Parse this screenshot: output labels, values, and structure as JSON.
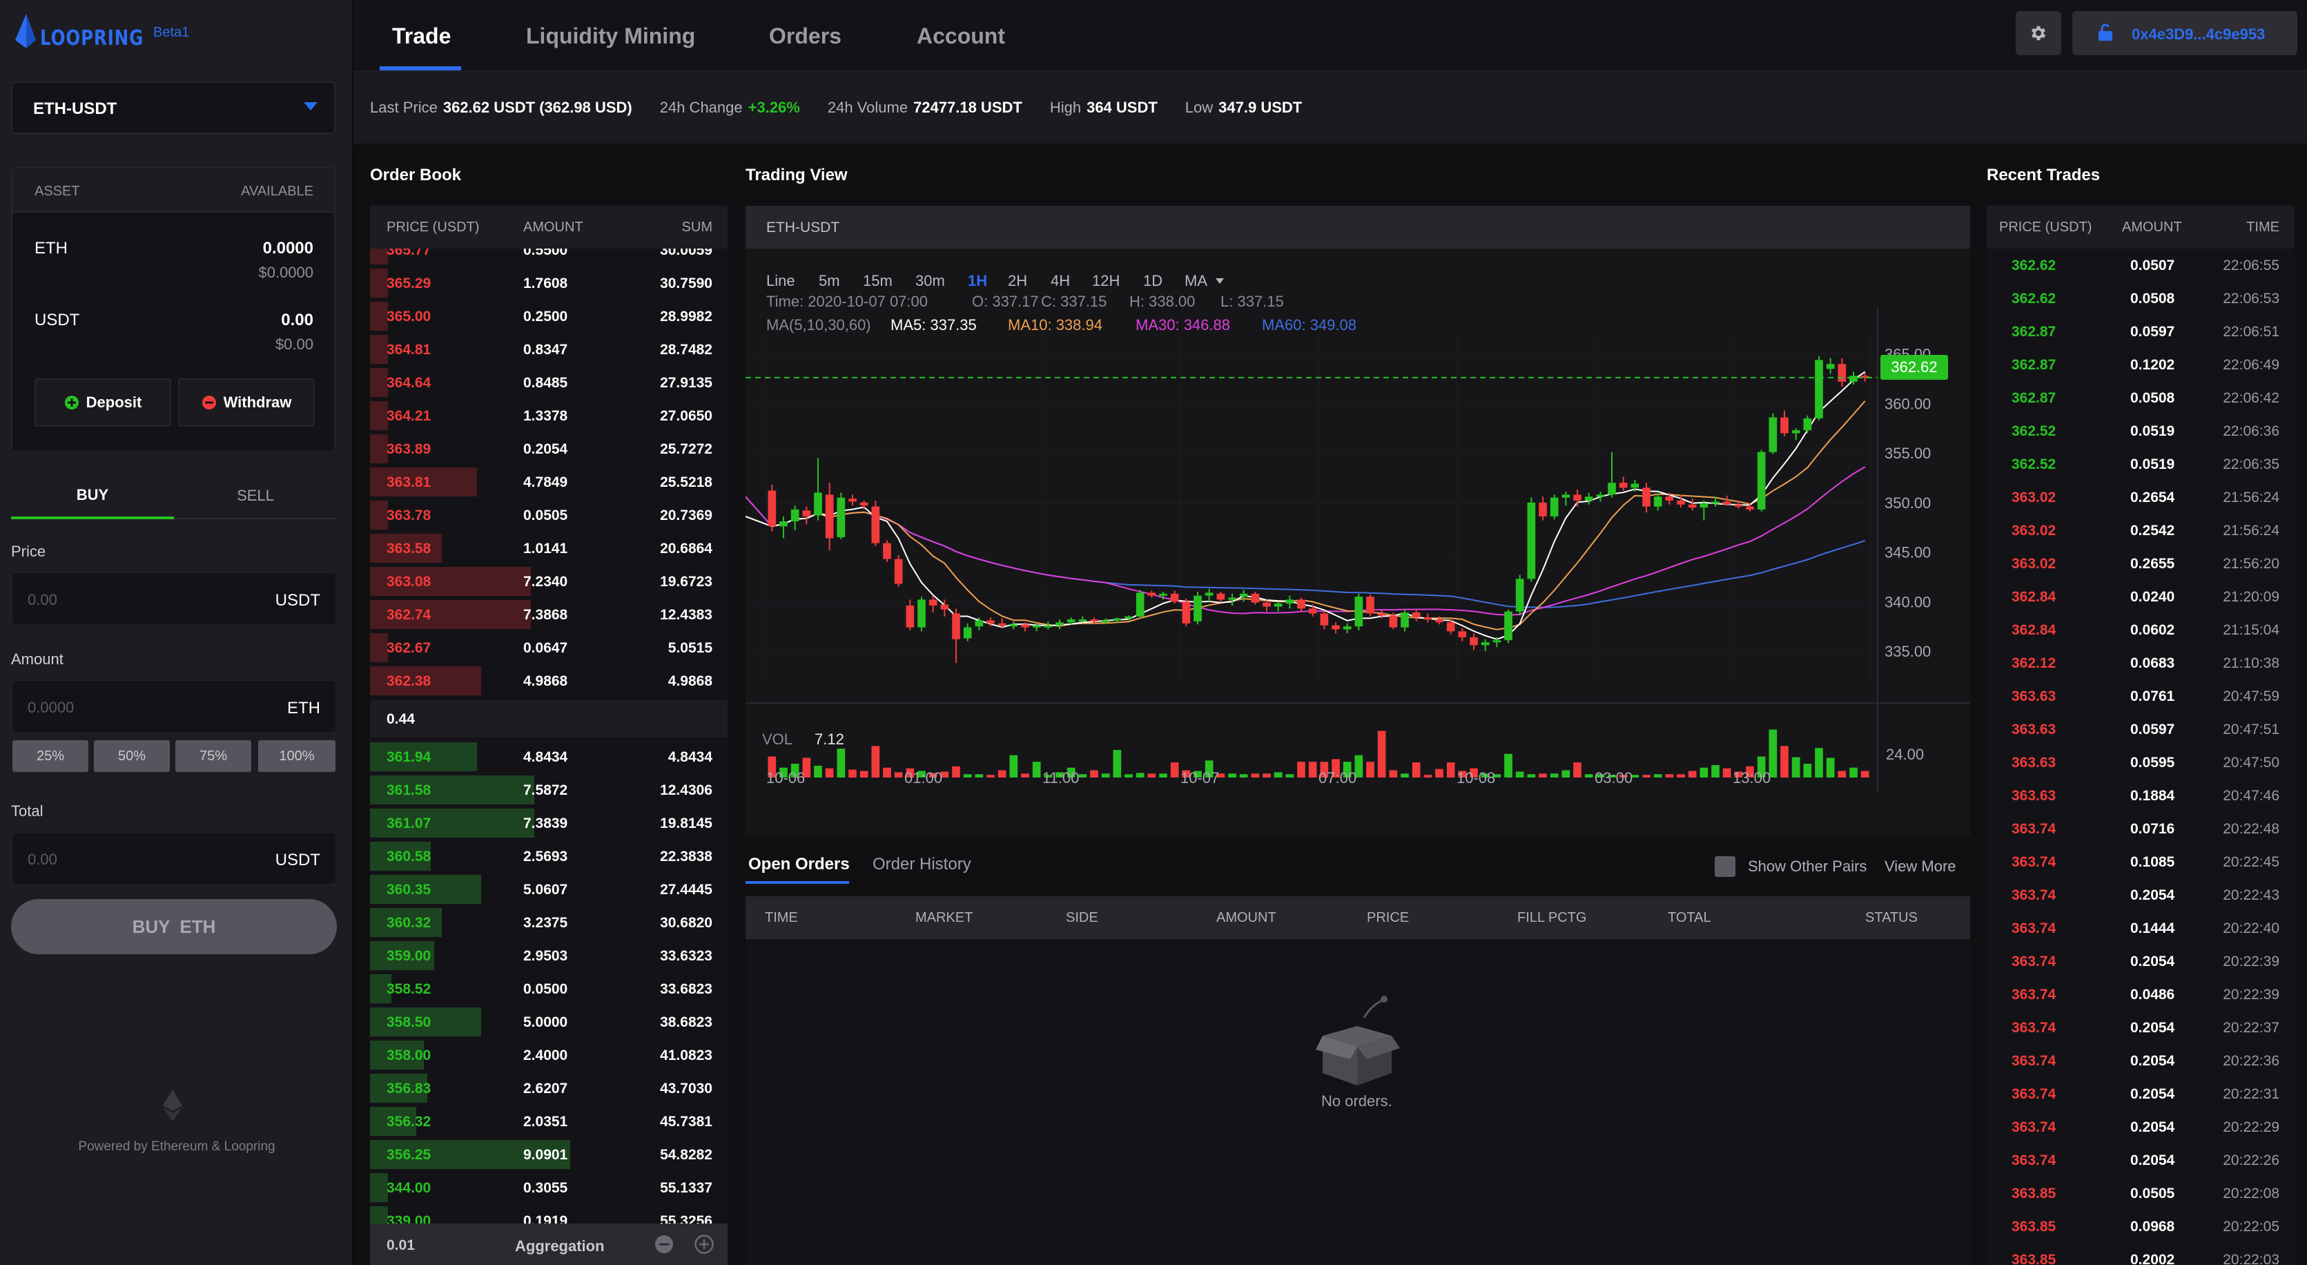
{
  "brand": {
    "name": "LOOPRING",
    "badge": "Beta1"
  },
  "market_select": {
    "value": "ETH-USDT"
  },
  "balances": {
    "header_asset": "ASSET",
    "header_available": "AVAILABLE",
    "rows": [
      {
        "asset": "ETH",
        "amount": "0.0000",
        "usd": "$0.0000"
      },
      {
        "asset": "USDT",
        "amount": "0.00",
        "usd": "$0.00"
      }
    ],
    "deposit_label": "Deposit",
    "withdraw_label": "Withdraw"
  },
  "order_form": {
    "buy_tab": "BUY",
    "sell_tab": "SELL",
    "price_label": "Price",
    "price_placeholder": "0.00",
    "price_unit": "USDT",
    "amount_label": "Amount",
    "amount_placeholder": "0.0000",
    "amount_unit": "ETH",
    "pcts": [
      "25%",
      "50%",
      "75%",
      "100%"
    ],
    "total_label": "Total",
    "total_placeholder": "0.00",
    "total_unit": "USDT",
    "submit_label": "BUY  ETH"
  },
  "footer": {
    "powered": "Powered by Ethereum & Loopring"
  },
  "nav": {
    "tabs": [
      "Trade",
      "Liquidity Mining",
      "Orders",
      "Account"
    ],
    "active": "Trade"
  },
  "wallet": {
    "address": "0x4e3D9...4c9e953"
  },
  "stats": {
    "last_price_label": "Last Price",
    "last_price": "362.62 USDT (362.98 USD)",
    "change_label": "24h Change",
    "change": "+3.26%",
    "volume_label": "24h Volume",
    "volume": "72477.18 USDT",
    "high_label": "High",
    "high": "364 USDT",
    "low_label": "Low",
    "low": "347.9 USDT"
  },
  "order_book": {
    "title": "Order Book",
    "headers": [
      "PRICE (USDT)",
      "AMOUNT",
      "SUM"
    ],
    "asks": [
      {
        "price": "365.77",
        "amount": "0.5500",
        "sum": "30.0059",
        "depth": 0.05
      },
      {
        "price": "365.29",
        "amount": "1.7608",
        "sum": "30.7590",
        "depth": 0.05
      },
      {
        "price": "365.00",
        "amount": "0.2500",
        "sum": "28.9982",
        "depth": 0.05
      },
      {
        "price": "364.81",
        "amount": "0.8347",
        "sum": "28.7482",
        "depth": 0.05
      },
      {
        "price": "364.64",
        "amount": "0.8485",
        "sum": "27.9135",
        "depth": 0.05
      },
      {
        "price": "364.21",
        "amount": "1.3378",
        "sum": "27.0650",
        "depth": 0.05
      },
      {
        "price": "363.89",
        "amount": "0.2054",
        "sum": "25.7272",
        "depth": 0.05
      },
      {
        "price": "363.81",
        "amount": "4.7849",
        "sum": "25.5218",
        "depth": 0.3
      },
      {
        "price": "363.78",
        "amount": "0.0505",
        "sum": "20.7369",
        "depth": 0.05
      },
      {
        "price": "363.58",
        "amount": "1.0141",
        "sum": "20.6864",
        "depth": 0.2
      },
      {
        "price": "363.08",
        "amount": "7.2340",
        "sum": "19.6723",
        "depth": 0.45
      },
      {
        "price": "362.74",
        "amount": "7.3868",
        "sum": "12.4383",
        "depth": 0.45
      },
      {
        "price": "362.67",
        "amount": "0.0647",
        "sum": "5.0515",
        "depth": 0.05
      },
      {
        "price": "362.38",
        "amount": "4.9868",
        "sum": "4.9868",
        "depth": 0.31
      }
    ],
    "spread": "0.44",
    "bids": [
      {
        "price": "361.94",
        "amount": "4.8434",
        "sum": "4.8434",
        "depth": 0.3
      },
      {
        "price": "361.58",
        "amount": "7.5872",
        "sum": "12.4306",
        "depth": 0.46
      },
      {
        "price": "361.07",
        "amount": "7.3839",
        "sum": "19.8145",
        "depth": 0.46
      },
      {
        "price": "360.58",
        "amount": "2.5693",
        "sum": "22.3838",
        "depth": 0.17
      },
      {
        "price": "360.35",
        "amount": "5.0607",
        "sum": "27.4445",
        "depth": 0.31
      },
      {
        "price": "360.32",
        "amount": "3.2375",
        "sum": "30.6820",
        "depth": 0.2
      },
      {
        "price": "359.00",
        "amount": "2.9503",
        "sum": "33.6323",
        "depth": 0.18
      },
      {
        "price": "358.52",
        "amount": "0.0500",
        "sum": "33.6823",
        "depth": 0.06
      },
      {
        "price": "358.50",
        "amount": "5.0000",
        "sum": "38.6823",
        "depth": 0.31
      },
      {
        "price": "358.00",
        "amount": "2.4000",
        "sum": "41.0823",
        "depth": 0.15
      },
      {
        "price": "356.83",
        "amount": "2.6207",
        "sum": "43.7030",
        "depth": 0.16
      },
      {
        "price": "356.32",
        "amount": "2.0351",
        "sum": "45.7381",
        "depth": 0.13
      },
      {
        "price": "356.25",
        "amount": "9.0901",
        "sum": "54.8282",
        "depth": 0.56
      },
      {
        "price": "344.00",
        "amount": "0.3055",
        "sum": "55.1337",
        "depth": 0.05
      },
      {
        "price": "339.00",
        "amount": "0.1919",
        "sum": "55.3256",
        "depth": 0.05
      }
    ],
    "aggregation_value": "0.01",
    "aggregation_label": "Aggregation"
  },
  "trading_view": {
    "title": "Trading View",
    "pair": "ETH-USDT",
    "timeframes": [
      "Line",
      "5m",
      "15m",
      "30m",
      "1H",
      "2H",
      "4H",
      "12H",
      "1D",
      "MA"
    ],
    "active_timeframe": "1H",
    "ohlc": {
      "time": "Time: 2020-10-07 07:00",
      "o": "O: 337.17",
      "c": "C: 337.15",
      "h": "H: 338.00",
      "l": "L: 337.15"
    },
    "ma": {
      "params": "MA(5,10,30,60)",
      "ma5": "MA5: 337.35",
      "ma10": "MA10: 338.94",
      "ma30": "MA30: 346.88",
      "ma60": "MA60: 349.08"
    },
    "current_price": "362.62",
    "vol_label": "VOL",
    "vol_value": "7.12",
    "vol_axis": "24.00"
  },
  "chart_data": {
    "type": "candlestick",
    "x_tick_labels": [
      "10-06",
      "01:00",
      "11:00",
      "10-07",
      "07:00",
      "10-08",
      "03:00",
      "13:00"
    ],
    "y_ticks": [
      "365.00",
      "360.00",
      "355.00",
      "350.00",
      "345.00",
      "340.00",
      "335.00"
    ],
    "ylim": [
      332,
      367
    ],
    "volume_ylim": [
      0,
      24
    ],
    "colors": {
      "up": "#27c222",
      "down": "#f23b3b",
      "ma5": "#ffffff",
      "ma10": "#f0a050",
      "ma30": "#e040e0",
      "ma60": "#3f6fe0"
    },
    "candles": [
      [
        351.2,
        351.8,
        347.1,
        347.6,
        3.2
      ],
      [
        347.6,
        348.6,
        346.4,
        348.1,
        1.5
      ],
      [
        348.1,
        349.7,
        347.2,
        349.3,
        2.1
      ],
      [
        349.2,
        349.6,
        347.8,
        348.6,
        3.0
      ],
      [
        348.7,
        354.5,
        348.2,
        351.0,
        1.8
      ],
      [
        350.8,
        352.0,
        345.2,
        346.4,
        1.4
      ],
      [
        346.5,
        351.0,
        346.3,
        350.5,
        4.4
      ],
      [
        350.4,
        350.8,
        349.7,
        350.1,
        1.2
      ],
      [
        350.0,
        350.2,
        349.3,
        349.7,
        1.0
      ],
      [
        349.6,
        350.2,
        345.6,
        345.9,
        4.8
      ],
      [
        345.9,
        346.2,
        344.0,
        344.3,
        1.5
      ],
      [
        344.3,
        344.7,
        341.5,
        341.8,
        0.8
      ],
      [
        339.6,
        340.2,
        337.1,
        337.4,
        1.4
      ],
      [
        337.4,
        340.5,
        337.0,
        340.2,
        1.0
      ],
      [
        340.2,
        340.6,
        338.9,
        339.6,
        0.7
      ],
      [
        339.7,
        340.2,
        338.5,
        339.2,
        0.9
      ],
      [
        338.8,
        339.3,
        333.8,
        336.2,
        1.7
      ],
      [
        336.3,
        337.8,
        336.0,
        337.4,
        0.5
      ],
      [
        337.5,
        338.4,
        337.1,
        338.1,
        0.5
      ],
      [
        338.1,
        338.4,
        337.5,
        337.8,
        0.4
      ],
      [
        337.8,
        338.3,
        337.3,
        337.6,
        1.1
      ],
      [
        337.6,
        338.0,
        337.2,
        337.7,
        3.4
      ],
      [
        337.7,
        337.9,
        337.0,
        337.4,
        0.6
      ],
      [
        337.4,
        337.8,
        337.0,
        337.6,
        2.4
      ],
      [
        337.6,
        338.0,
        337.2,
        337.6,
        0.4
      ],
      [
        337.6,
        338.2,
        337.2,
        337.9,
        0.8
      ],
      [
        337.9,
        338.4,
        337.7,
        338.2,
        1.5
      ],
      [
        338.2,
        338.5,
        337.9,
        338.2,
        0.5
      ],
      [
        338.2,
        338.4,
        337.7,
        338.0,
        1.1
      ],
      [
        338.0,
        338.3,
        337.8,
        338.1,
        0.6
      ],
      [
        338.1,
        338.4,
        337.9,
        338.3,
        4.2
      ],
      [
        338.3,
        338.6,
        338.1,
        338.5,
        0.5
      ],
      [
        338.5,
        341.2,
        338.3,
        340.9,
        0.7
      ],
      [
        340.9,
        341.1,
        340.4,
        340.6,
        0.6
      ],
      [
        340.6,
        341.0,
        340.2,
        340.8,
        0.6
      ],
      [
        340.8,
        341.1,
        339.8,
        340.0,
        2.3
      ],
      [
        340.0,
        340.3,
        337.5,
        337.8,
        1.1
      ],
      [
        338.0,
        341.0,
        337.7,
        340.6,
        1.0
      ],
      [
        340.6,
        341.3,
        340.0,
        340.9,
        2.6
      ],
      [
        340.8,
        341.0,
        339.9,
        340.2,
        0.6
      ],
      [
        340.2,
        340.8,
        339.6,
        340.4,
        0.6
      ],
      [
        340.5,
        341.2,
        340.0,
        340.8,
        0.5
      ],
      [
        340.8,
        341.0,
        339.7,
        339.9,
        0.6
      ],
      [
        339.9,
        340.2,
        339.0,
        339.5,
        0.6
      ],
      [
        339.5,
        340.0,
        339.0,
        339.8,
        0.8
      ],
      [
        339.8,
        340.6,
        339.3,
        340.2,
        0.5
      ],
      [
        340.2,
        340.4,
        339.0,
        339.3,
        2.4
      ],
      [
        339.3,
        339.7,
        338.5,
        338.8,
        2.4
      ],
      [
        338.8,
        339.1,
        337.2,
        337.6,
        2.4
      ],
      [
        337.6,
        337.9,
        336.8,
        337.2,
        2.8
      ],
      [
        337.2,
        337.8,
        336.8,
        337.5,
        2.4
      ],
      [
        337.5,
        340.8,
        337.1,
        340.5,
        3.4
      ],
      [
        340.5,
        340.7,
        338.5,
        338.8,
        2.4
      ],
      [
        338.8,
        339.1,
        338.3,
        338.6,
        7.1
      ],
      [
        338.6,
        338.9,
        337.2,
        337.4,
        1.1
      ],
      [
        337.4,
        339.2,
        337.0,
        338.9,
        0.6
      ],
      [
        338.9,
        339.3,
        338.0,
        338.4,
        2.3
      ],
      [
        338.4,
        338.8,
        337.9,
        338.2,
        0.4
      ],
      [
        338.2,
        338.5,
        337.7,
        337.9,
        1.3
      ],
      [
        337.9,
        338.2,
        336.7,
        337.0,
        2.3
      ],
      [
        337.0,
        337.3,
        336.0,
        336.4,
        1.0
      ],
      [
        336.4,
        336.8,
        335.1,
        335.6,
        1.4
      ],
      [
        335.6,
        336.2,
        335.0,
        335.9,
        0.6
      ],
      [
        335.9,
        336.4,
        335.4,
        336.1,
        0.5
      ],
      [
        336.1,
        339.2,
        335.8,
        339.0,
        3.6
      ],
      [
        339.0,
        342.7,
        338.6,
        342.3,
        0.9
      ],
      [
        342.3,
        350.5,
        342.0,
        350.0,
        0.5
      ],
      [
        350.0,
        350.6,
        348.2,
        348.6,
        0.6
      ],
      [
        348.6,
        350.8,
        348.3,
        350.5,
        0.6
      ],
      [
        350.5,
        351.1,
        349.7,
        350.8,
        1.1
      ],
      [
        350.8,
        351.3,
        349.6,
        350.2,
        2.3
      ],
      [
        350.2,
        351.0,
        349.8,
        350.6,
        0.5
      ],
      [
        350.6,
        351.1,
        350.1,
        350.8,
        0.5
      ],
      [
        350.8,
        355.1,
        350.5,
        352.0,
        0.4
      ],
      [
        352.0,
        352.6,
        351.2,
        351.5,
        0.4
      ],
      [
        351.5,
        352.3,
        351.1,
        351.9,
        0.4
      ],
      [
        351.5,
        352.0,
        349.0,
        349.6,
        0.4
      ],
      [
        349.6,
        350.9,
        349.2,
        350.6,
        0.5
      ],
      [
        350.6,
        351.0,
        349.8,
        350.2,
        0.5
      ],
      [
        350.2,
        350.8,
        349.5,
        349.8,
        0.5
      ],
      [
        349.8,
        350.4,
        349.2,
        349.5,
        1.0
      ],
      [
        349.5,
        350.2,
        348.2,
        349.9,
        1.5
      ],
      [
        349.9,
        350.6,
        349.6,
        350.1,
        1.9
      ],
      [
        350.1,
        350.7,
        349.7,
        349.8,
        1.4
      ],
      [
        349.8,
        350.2,
        349.4,
        349.6,
        0.9
      ],
      [
        349.6,
        349.9,
        349.1,
        349.3,
        1.7
      ],
      [
        349.3,
        355.3,
        349.1,
        355.1,
        3.2
      ],
      [
        355.1,
        359.0,
        354.9,
        358.6,
        7.3
      ],
      [
        358.6,
        359.3,
        356.7,
        357.0,
        4.8
      ],
      [
        357.0,
        357.5,
        356.3,
        357.3,
        3.1
      ],
      [
        357.3,
        358.8,
        357.0,
        358.5,
        2.1
      ],
      [
        358.5,
        364.8,
        358.3,
        364.4,
        4.5
      ],
      [
        363.5,
        364.6,
        363.0,
        364.0,
        3.0
      ],
      [
        364.0,
        364.6,
        361.7,
        362.2,
        1.0
      ],
      [
        362.2,
        363.2,
        361.9,
        362.8,
        1.5
      ],
      [
        362.8,
        363.1,
        362.2,
        362.6,
        1.0
      ]
    ]
  },
  "orders": {
    "tabs": [
      "Open Orders",
      "Order History"
    ],
    "active_tab": "Open Orders",
    "show_other_pairs": "Show Other Pairs",
    "view_more": "View More",
    "headers": [
      "TIME",
      "MARKET",
      "SIDE",
      "AMOUNT",
      "PRICE",
      "FILL PCTG",
      "TOTAL",
      "STATUS"
    ],
    "empty": "No orders."
  },
  "recent_trades": {
    "title": "Recent Trades",
    "headers": [
      "PRICE (USDT)",
      "AMOUNT",
      "TIME"
    ],
    "rows": [
      {
        "price": "362.62",
        "amount": "0.0507",
        "time": "22:06:55",
        "side": "buy"
      },
      {
        "price": "362.62",
        "amount": "0.0508",
        "time": "22:06:53",
        "side": "buy"
      },
      {
        "price": "362.87",
        "amount": "0.0597",
        "time": "22:06:51",
        "side": "buy"
      },
      {
        "price": "362.87",
        "amount": "0.1202",
        "time": "22:06:49",
        "side": "buy"
      },
      {
        "price": "362.87",
        "amount": "0.0508",
        "time": "22:06:42",
        "side": "buy"
      },
      {
        "price": "362.52",
        "amount": "0.0519",
        "time": "22:06:36",
        "side": "buy"
      },
      {
        "price": "362.52",
        "amount": "0.0519",
        "time": "22:06:35",
        "side": "buy"
      },
      {
        "price": "363.02",
        "amount": "0.2654",
        "time": "21:56:24",
        "side": "sell"
      },
      {
        "price": "363.02",
        "amount": "0.2542",
        "time": "21:56:24",
        "side": "sell"
      },
      {
        "price": "363.02",
        "amount": "0.2655",
        "time": "21:56:20",
        "side": "sell"
      },
      {
        "price": "362.84",
        "amount": "0.0240",
        "time": "21:20:09",
        "side": "sell"
      },
      {
        "price": "362.84",
        "amount": "0.0602",
        "time": "21:15:04",
        "side": "sell"
      },
      {
        "price": "362.12",
        "amount": "0.0683",
        "time": "21:10:38",
        "side": "sell"
      },
      {
        "price": "363.63",
        "amount": "0.0761",
        "time": "20:47:59",
        "side": "sell"
      },
      {
        "price": "363.63",
        "amount": "0.0597",
        "time": "20:47:51",
        "side": "sell"
      },
      {
        "price": "363.63",
        "amount": "0.0595",
        "time": "20:47:50",
        "side": "sell"
      },
      {
        "price": "363.63",
        "amount": "0.1884",
        "time": "20:47:46",
        "side": "sell"
      },
      {
        "price": "363.74",
        "amount": "0.0716",
        "time": "20:22:48",
        "side": "sell"
      },
      {
        "price": "363.74",
        "amount": "0.1085",
        "time": "20:22:45",
        "side": "sell"
      },
      {
        "price": "363.74",
        "amount": "0.2054",
        "time": "20:22:43",
        "side": "sell"
      },
      {
        "price": "363.74",
        "amount": "0.1444",
        "time": "20:22:40",
        "side": "sell"
      },
      {
        "price": "363.74",
        "amount": "0.2054",
        "time": "20:22:39",
        "side": "sell"
      },
      {
        "price": "363.74",
        "amount": "0.0486",
        "time": "20:22:39",
        "side": "sell"
      },
      {
        "price": "363.74",
        "amount": "0.2054",
        "time": "20:22:37",
        "side": "sell"
      },
      {
        "price": "363.74",
        "amount": "0.2054",
        "time": "20:22:36",
        "side": "sell"
      },
      {
        "price": "363.74",
        "amount": "0.2054",
        "time": "20:22:31",
        "side": "sell"
      },
      {
        "price": "363.74",
        "amount": "0.2054",
        "time": "20:22:29",
        "side": "sell"
      },
      {
        "price": "363.74",
        "amount": "0.2054",
        "time": "20:22:26",
        "side": "sell"
      },
      {
        "price": "363.85",
        "amount": "0.0505",
        "time": "20:22:08",
        "side": "sell"
      },
      {
        "price": "363.85",
        "amount": "0.0968",
        "time": "20:22:05",
        "side": "sell"
      },
      {
        "price": "363.85",
        "amount": "0.2002",
        "time": "20:22:03",
        "side": "sell"
      }
    ]
  }
}
